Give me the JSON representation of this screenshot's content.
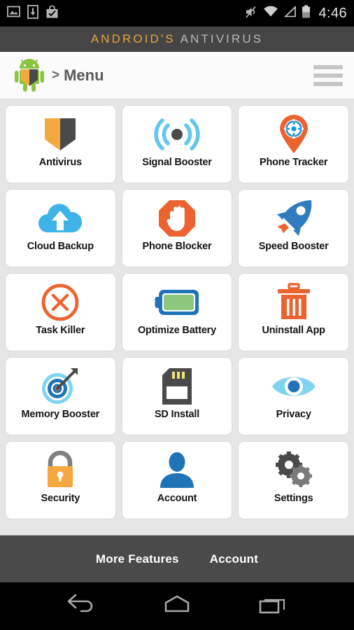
{
  "statusbar": {
    "left_icons": [
      "image-icon",
      "download-icon",
      "play-store-bag-icon"
    ],
    "right_icons": [
      "mute-icon",
      "wifi-icon",
      "cell-signal-icon",
      "battery-icon"
    ],
    "time": "4:46"
  },
  "brand": {
    "part1": "ANDROID'S",
    "part2": "ANTIVIRUS",
    "color1": "#e8a33d",
    "color2": "#b9b9b9",
    "bg": "#454545"
  },
  "header": {
    "logo": "android-shield-logo",
    "separator": ">",
    "title": "Menu",
    "menu_icon": "hamburger-menu-icon"
  },
  "grid": {
    "tiles": [
      {
        "label": "Antivirus",
        "icon": "shield-icon"
      },
      {
        "label": "Signal Booster",
        "icon": "signal-waves-icon"
      },
      {
        "label": "Phone Tracker",
        "icon": "map-pin-crosshair-icon"
      },
      {
        "label": "Cloud Backup",
        "icon": "cloud-upload-icon"
      },
      {
        "label": "Phone Blocker",
        "icon": "stop-hand-icon"
      },
      {
        "label": "Speed Booster",
        "icon": "rocket-icon"
      },
      {
        "label": "Task Killer",
        "icon": "circle-x-icon"
      },
      {
        "label": "Optimize Battery",
        "icon": "battery-full-icon"
      },
      {
        "label": "Uninstall App",
        "icon": "trash-can-icon"
      },
      {
        "label": "Memory Booster",
        "icon": "target-arrow-icon"
      },
      {
        "label": "SD Install",
        "icon": "sd-card-icon"
      },
      {
        "label": "Privacy",
        "icon": "eye-icon"
      },
      {
        "label": "Security",
        "icon": "padlock-icon"
      },
      {
        "label": "Account",
        "icon": "person-icon"
      },
      {
        "label": "Settings",
        "icon": "gears-icon"
      }
    ]
  },
  "tabbar": {
    "items": [
      {
        "label": "More Features"
      },
      {
        "label": "Account"
      }
    ]
  },
  "navbar": {
    "buttons": [
      "back-button",
      "home-button",
      "recents-button"
    ]
  },
  "colors": {
    "accent_orange": "#ec6330",
    "accent_amber": "#f5a83f",
    "accent_blue": "#1f74b8",
    "accent_lightblue": "#62c6ee",
    "dark_gray": "#4a4a4a",
    "page_bg": "#e6e6e6"
  }
}
